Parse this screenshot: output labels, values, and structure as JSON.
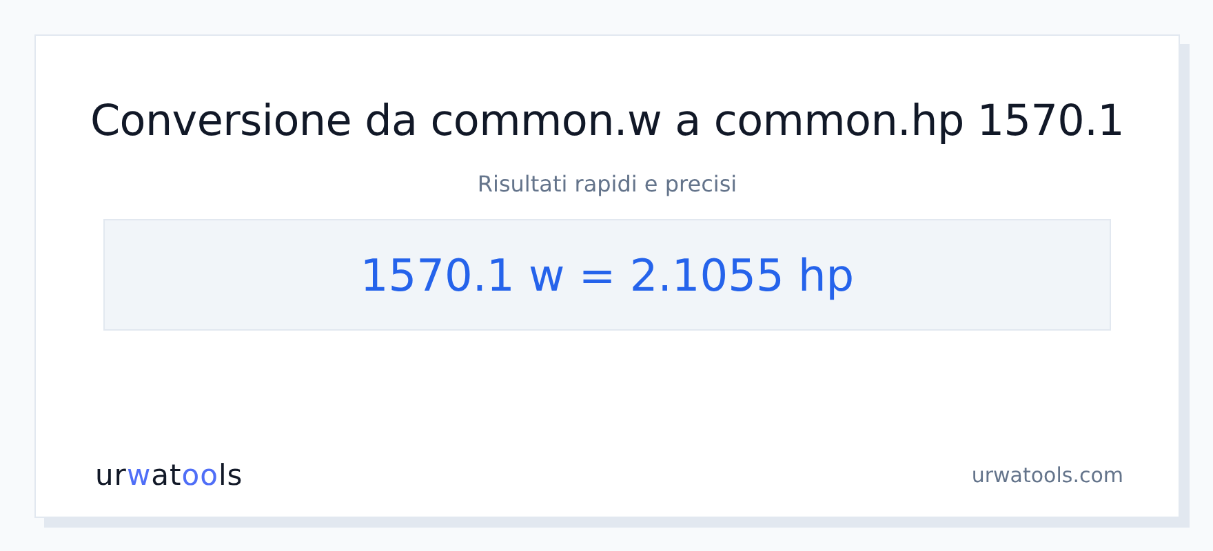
{
  "title": "Conversione da common.w a common.hp 1570.1",
  "subtitle": "Risultati rapidi e precisi",
  "result": "1570.1 w = 2.1055 hp",
  "logo": [
    {
      "text": "ur",
      "color": "#111827"
    },
    {
      "text": "w",
      "color": "#4f6ef7"
    },
    {
      "text": "at",
      "color": "#111827"
    },
    {
      "text": "oo",
      "color": "#4f6ef7"
    },
    {
      "text": "ls",
      "color": "#111827"
    }
  ],
  "site": "urwatools.com"
}
